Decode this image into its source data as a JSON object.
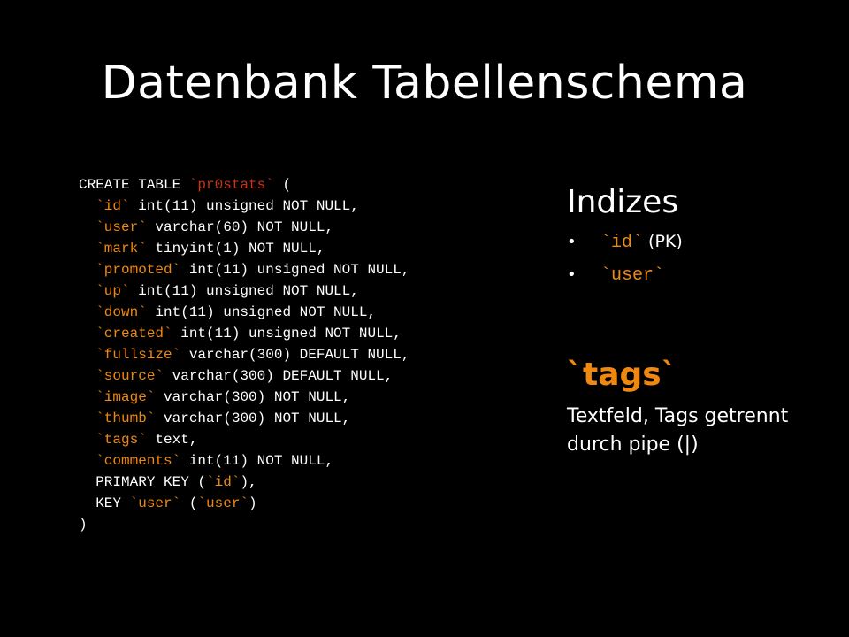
{
  "slide": {
    "title": "Datenbank Tabellenschema",
    "colors": {
      "background": "#000000",
      "text": "#ffffff",
      "accent_orange": "#f0880f",
      "accent_red": "#cc3311"
    }
  },
  "code": {
    "lines": [
      {
        "kind": "tbl",
        "pre": "CREATE TABLE ",
        "name": "`pr0stats`",
        "post": " ("
      },
      {
        "kind": "col",
        "pre": "  ",
        "name": "`id`",
        "post": " int(11) unsigned NOT NULL,"
      },
      {
        "kind": "col",
        "pre": "  ",
        "name": "`user`",
        "post": " varchar(60) NOT NULL,"
      },
      {
        "kind": "col",
        "pre": "  ",
        "name": "`mark`",
        "post": " tinyint(1) NOT NULL,"
      },
      {
        "kind": "col",
        "pre": "  ",
        "name": "`promoted`",
        "post": " int(11) unsigned NOT NULL,"
      },
      {
        "kind": "col",
        "pre": "  ",
        "name": "`up`",
        "post": " int(11) unsigned NOT NULL,"
      },
      {
        "kind": "col",
        "pre": "  ",
        "name": "`down`",
        "post": " int(11) unsigned NOT NULL,"
      },
      {
        "kind": "col",
        "pre": "  ",
        "name": "`created`",
        "post": " int(11) unsigned NOT NULL,"
      },
      {
        "kind": "col",
        "pre": "  ",
        "name": "`fullsize`",
        "post": " varchar(300) DEFAULT NULL,"
      },
      {
        "kind": "col",
        "pre": "  ",
        "name": "`source`",
        "post": " varchar(300) DEFAULT NULL,"
      },
      {
        "kind": "col",
        "pre": "  ",
        "name": "`image`",
        "post": " varchar(300) NOT NULL,"
      },
      {
        "kind": "col",
        "pre": "  ",
        "name": "`thumb`",
        "post": " varchar(300) NOT NULL,"
      },
      {
        "kind": "col",
        "pre": "  ",
        "name": "`tags`",
        "post": " text,"
      },
      {
        "kind": "col",
        "pre": "  ",
        "name": "`comments`",
        "post": " int(11) NOT NULL,"
      },
      {
        "kind": "col",
        "pre": "  PRIMARY KEY (",
        "name": "`id`",
        "post": "),"
      },
      {
        "kind": "key",
        "pre": "  KEY ",
        "name": "`user`",
        "mid": " (",
        "name2": "`user`",
        "post": ")"
      },
      {
        "kind": "plain",
        "pre": ")",
        "name": "",
        "post": ""
      }
    ]
  },
  "indexes": {
    "heading": "Indizes",
    "bullet": "•",
    "items": [
      {
        "code": "`id`",
        "note": " (PK)"
      },
      {
        "code": "`user`",
        "note": ""
      }
    ]
  },
  "tags": {
    "heading": "`tags`",
    "description": "Textfeld, Tags getrennt durch pipe (|)"
  }
}
